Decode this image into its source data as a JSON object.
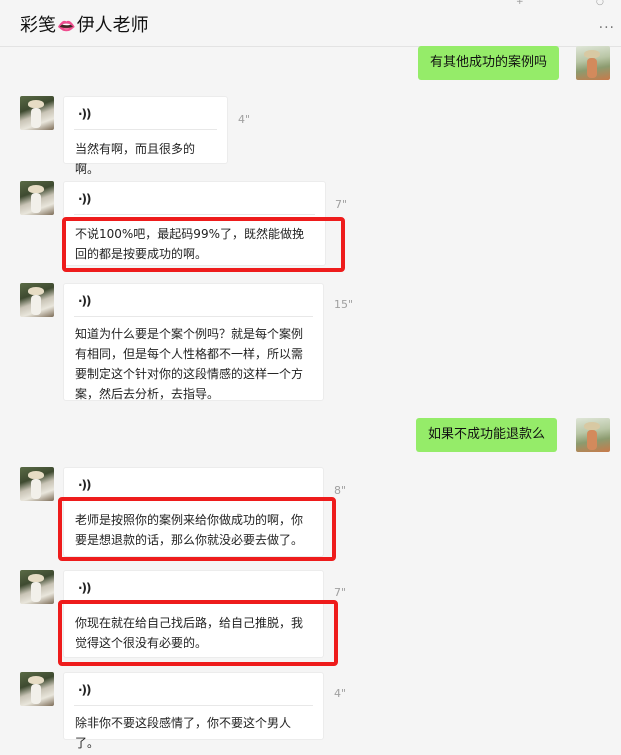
{
  "header": {
    "title_part1": "彩笺",
    "lips_glyph": "👄",
    "title_part2": "伊人老师",
    "more_label": "...",
    "top_glyph_a": "+",
    "top_glyph_b": "○"
  },
  "messages": [
    {
      "from": "me",
      "text": "有其他成功的案例吗"
    },
    {
      "from": "them",
      "type": "voice",
      "duration": "4\"",
      "transcript": "当然有啊，而且很多的啊。"
    },
    {
      "from": "them",
      "type": "voice",
      "duration": "7\"",
      "transcript": "不说100%吧，最起码99%了，既然能做挽回的都是按要成功的啊。",
      "highlighted": true
    },
    {
      "from": "them",
      "type": "voice",
      "duration": "15\"",
      "transcript": "知道为什么要是个案个例吗？就是每个案例有相同，但是每个人性格都不一样，所以需要制定这个针对你的这段情感的这样一个方案，然后去分析，去指导。"
    },
    {
      "from": "me",
      "text": "如果不成功能退款么"
    },
    {
      "from": "them",
      "type": "voice",
      "duration": "8\"",
      "transcript": "老师是按照你的案例来给你做成功的啊，你要是想退款的话，那么你就没必要去做了。",
      "highlighted": true
    },
    {
      "from": "them",
      "type": "voice",
      "duration": "7\"",
      "transcript": "你现在就在给自己找后路，给自己推脱，我觉得这个很没有必要的。",
      "highlighted": true
    },
    {
      "from": "them",
      "type": "voice",
      "duration": "4\"",
      "transcript": "除非你不要这段感情了，你不要这个男人了。"
    }
  ],
  "voice_icon": "·))",
  "colors": {
    "outgoing_bubble": "#95ec69",
    "incoming_bubble": "#ffffff",
    "highlight_box": "#ee1c1c",
    "background": "#f5f5f5"
  }
}
